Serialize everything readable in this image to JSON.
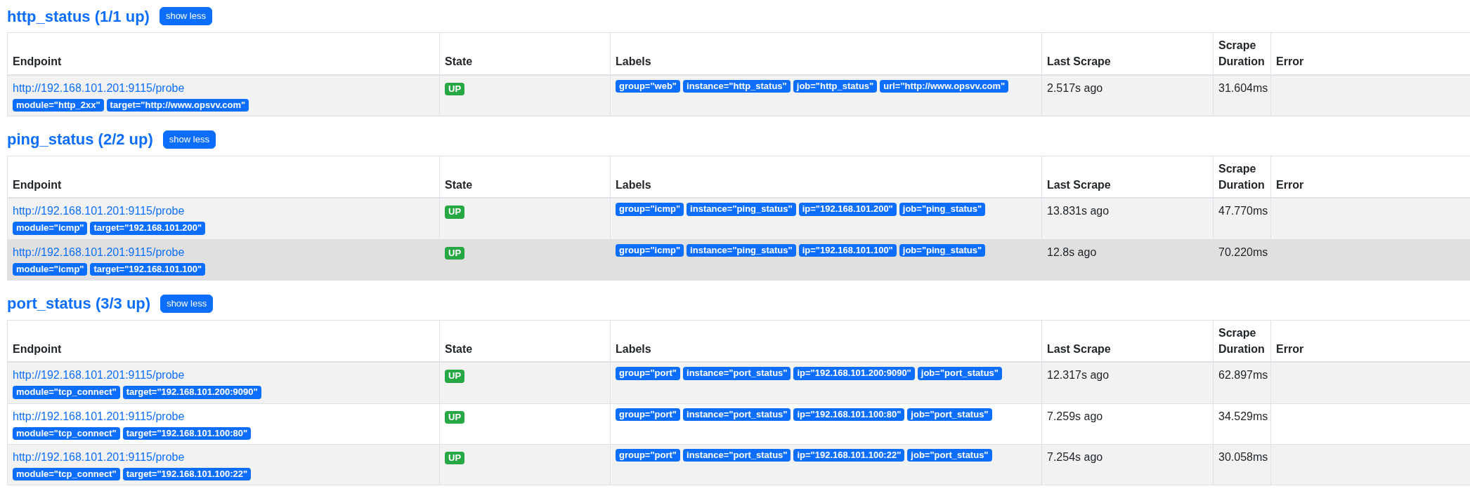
{
  "groups": [
    {
      "title": "http_status (1/1 up)",
      "button": "show less",
      "columns": [
        "Endpoint",
        "State",
        "Labels",
        "Last Scrape",
        "Scrape Duration",
        "Error"
      ],
      "rows": [
        {
          "endpoint": "http://192.168.101.201:9115/probe",
          "endpoint_labels": [
            "module=\"http_2xx\"",
            "target=\"http://www.opsvv.com\""
          ],
          "state": {
            "text": "UP",
            "color": "#28a745"
          },
          "labels": [
            "group=\"web\"",
            "instance=\"http_status\"",
            "job=\"http_status\"",
            "url=\"http://www.opsvv.com\""
          ],
          "last_scrape": "2.517s ago",
          "scrape_duration": "31.604ms",
          "hovered": false
        }
      ]
    },
    {
      "title": "ping_status (2/2 up)",
      "button": "show less",
      "columns": [
        "Endpoint",
        "State",
        "Labels",
        "Last Scrape",
        "Scrape Duration",
        "Error"
      ],
      "rows": [
        {
          "endpoint": "http://192.168.101.201:9115/probe",
          "endpoint_labels": [
            "module=\"icmp\"",
            "target=\"192.168.101.200\""
          ],
          "state": {
            "text": "UP",
            "color": "#28a745"
          },
          "labels": [
            "group=\"icmp\"",
            "instance=\"ping_status\"",
            "ip=\"192.168.101.200\"",
            "job=\"ping_status\""
          ],
          "last_scrape": "13.831s ago",
          "scrape_duration": "47.770ms",
          "hovered": false
        },
        {
          "endpoint": "http://192.168.101.201:9115/probe",
          "endpoint_labels": [
            "module=\"icmp\"",
            "target=\"192.168.101.100\""
          ],
          "state": {
            "text": "UP",
            "color": "#28a745"
          },
          "labels": [
            "group=\"icmp\"",
            "instance=\"ping_status\"",
            "ip=\"192.168.101.100\"",
            "job=\"ping_status\""
          ],
          "last_scrape": "12.8s ago",
          "scrape_duration": "70.220ms",
          "hovered": true
        }
      ]
    },
    {
      "title": "port_status (3/3 up)",
      "button": "show less",
      "columns": [
        "Endpoint",
        "State",
        "Labels",
        "Last Scrape",
        "Scrape Duration",
        "Error"
      ],
      "rows": [
        {
          "endpoint": "http://192.168.101.201:9115/probe",
          "endpoint_labels": [
            "module=\"tcp_connect\"",
            "target=\"192.168.101.200:9090\""
          ],
          "state": {
            "text": "UP",
            "color": "#28a745"
          },
          "labels": [
            "group=\"port\"",
            "instance=\"port_status\"",
            "ip=\"192.168.101.200:9090\"",
            "job=\"port_status\""
          ],
          "last_scrape": "12.317s ago",
          "scrape_duration": "62.897ms",
          "hovered": false
        },
        {
          "endpoint": "http://192.168.101.201:9115/probe",
          "endpoint_labels": [
            "module=\"tcp_connect\"",
            "target=\"192.168.101.100:80\""
          ],
          "state": {
            "text": "UP",
            "color": "#28a745"
          },
          "labels": [
            "group=\"port\"",
            "instance=\"port_status\"",
            "ip=\"192.168.101.100:80\"",
            "job=\"port_status\""
          ],
          "last_scrape": "7.259s ago",
          "scrape_duration": "34.529ms",
          "hovered": false
        },
        {
          "endpoint": "http://192.168.101.201:9115/probe",
          "endpoint_labels": [
            "module=\"tcp_connect\"",
            "target=\"192.168.101.100:22\""
          ],
          "state": {
            "text": "UP",
            "color": "#28a745"
          },
          "labels": [
            "group=\"port\"",
            "instance=\"port_status\"",
            "ip=\"192.168.101.100:22\"",
            "job=\"port_status\""
          ],
          "last_scrape": "7.254s ago",
          "scrape_duration": "30.058ms",
          "hovered": false
        }
      ]
    }
  ]
}
